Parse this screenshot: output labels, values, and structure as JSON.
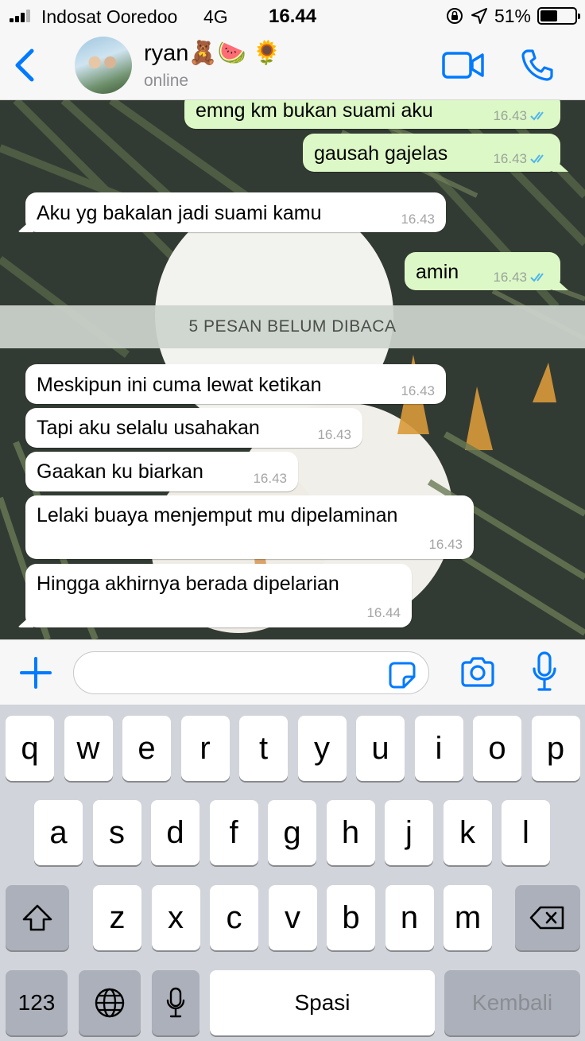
{
  "status_bar": {
    "carrier": "Indosat Ooredoo",
    "network": "4G",
    "time": "16.44",
    "battery_percent": "51%",
    "battery_level": 0.51,
    "signal_bars": 3,
    "icons": [
      "rotation-lock-icon",
      "location-arrow-icon",
      "battery-icon"
    ]
  },
  "header": {
    "contact_name": "ryan🧸🍉 🌻",
    "contact_status": "online",
    "accent_color": "#007aff"
  },
  "messages_top": [
    {
      "direction": "out",
      "text": "emng km bukan suami aku",
      "time": "16.43",
      "read": true
    },
    {
      "direction": "out",
      "text": "gausah gajelas",
      "time": "16.43",
      "read": true
    },
    {
      "direction": "in",
      "text": "Aku yg bakalan jadi suami kamu",
      "time": "16.43"
    },
    {
      "direction": "out",
      "text": "amin",
      "time": "16.43",
      "read": true
    }
  ],
  "unread_banner": "5 PESAN BELUM DIBACA",
  "messages_unread": [
    {
      "direction": "in",
      "text": "Meskipun ini cuma lewat ketikan",
      "time": "16.43"
    },
    {
      "direction": "in",
      "text": "Tapi aku selalu usahakan",
      "time": "16.43"
    },
    {
      "direction": "in",
      "text": "Gaakan ku biarkan",
      "time": "16.43"
    },
    {
      "direction": "in",
      "text": "Lelaki buaya menjemput mu dipelaminan",
      "time": "16.43"
    },
    {
      "direction": "in",
      "text": "Hingga akhirnya berada dipelarian",
      "time": "16.44"
    }
  ],
  "input": {
    "value": "",
    "placeholder": ""
  },
  "keyboard": {
    "row1": [
      "q",
      "w",
      "e",
      "r",
      "t",
      "y",
      "u",
      "i",
      "o",
      "p"
    ],
    "row2": [
      "a",
      "s",
      "d",
      "f",
      "g",
      "h",
      "j",
      "k",
      "l"
    ],
    "row3": [
      "z",
      "x",
      "c",
      "v",
      "b",
      "n",
      "m"
    ],
    "numbers_label": "123",
    "space_label": "Spasi",
    "return_label": "Kembali"
  },
  "colors": {
    "outgoing_bubble": "#dcf8c6",
    "incoming_bubble": "#ffffff",
    "read_ticks": "#4fb6ec"
  }
}
